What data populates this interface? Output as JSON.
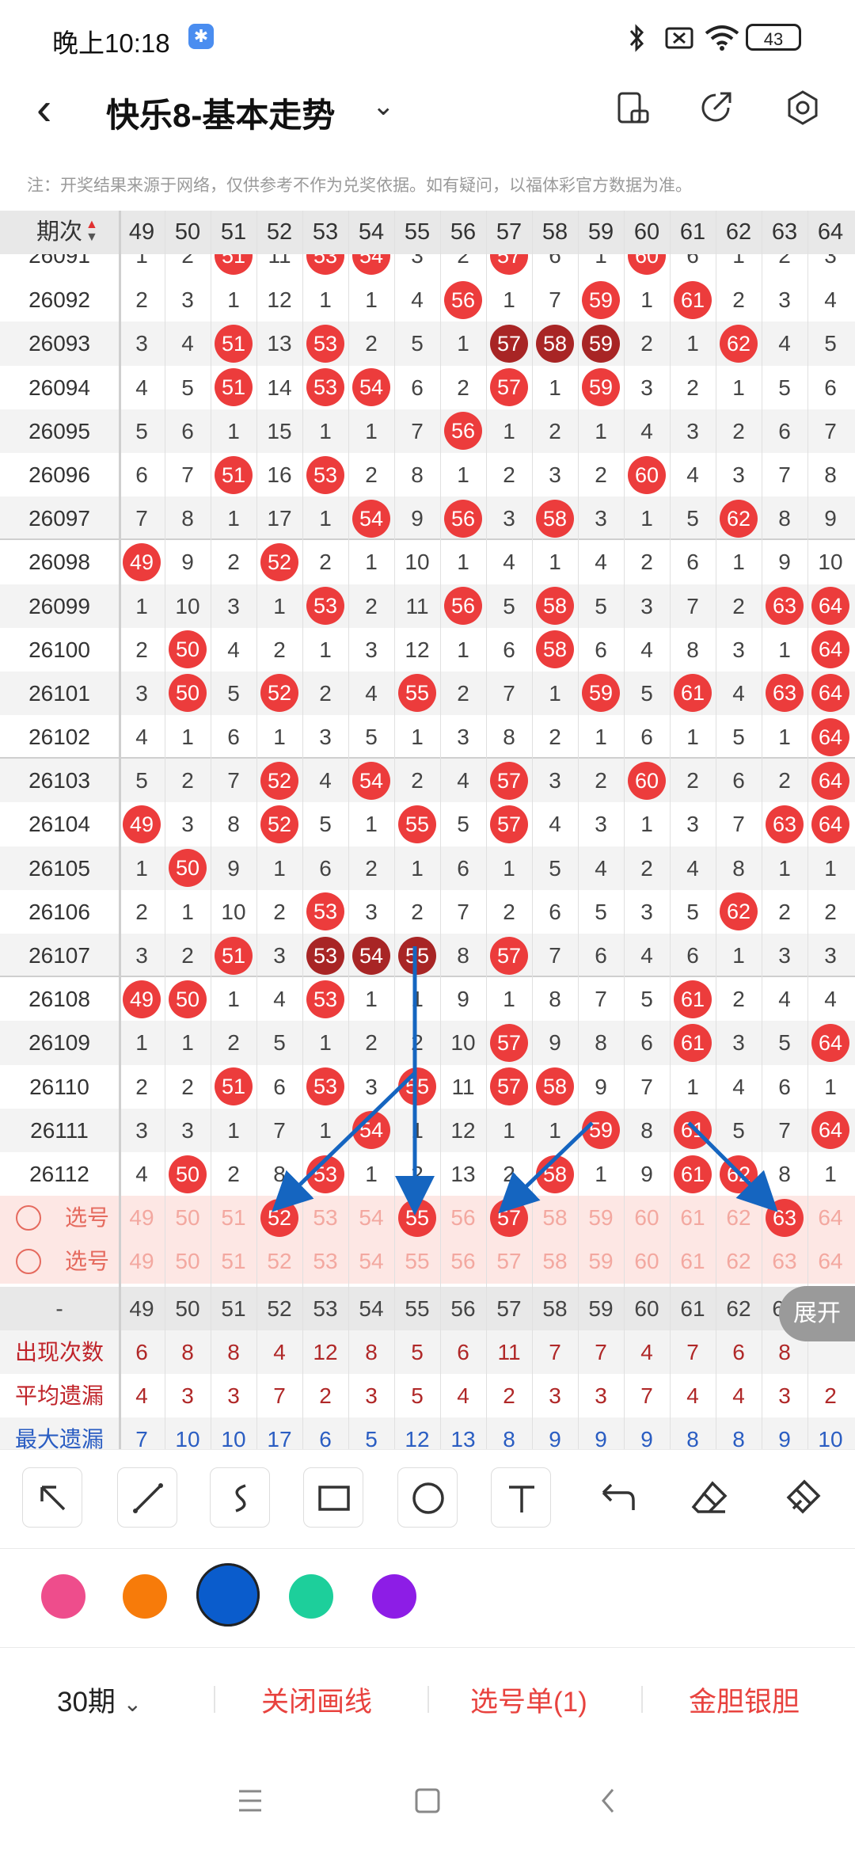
{
  "status_bar": {
    "time": "晚上10:18",
    "battery": "43"
  },
  "header": {
    "title": "快乐8-基本走势"
  },
  "notice": "注：开奖结果来源于网络，仅供参考不作为兑奖依据。如有疑问，以福体彩官方数据为准。",
  "table": {
    "period_header": "期次",
    "columns": [
      "49",
      "50",
      "51",
      "52",
      "53",
      "54",
      "55",
      "56",
      "57",
      "58",
      "59",
      "60",
      "61",
      "62",
      "63",
      "64"
    ],
    "partial_row": {
      "period": "26091",
      "cells": [
        "1",
        "2",
        "51",
        "11",
        "53",
        "54",
        "3",
        "2",
        "57",
        "6",
        "1",
        "60",
        "6",
        "1",
        "2",
        "3"
      ]
    },
    "rows": [
      {
        "period": "26092",
        "cells": [
          "2",
          "3",
          "1",
          "12",
          "1",
          "1",
          "4",
          "56",
          "1",
          "7",
          "59",
          "1",
          "61",
          "2",
          "3",
          "4"
        ]
      },
      {
        "period": "26093",
        "cells": [
          "3",
          "4",
          "51",
          "13",
          "53",
          "2",
          "5",
          "1",
          "57",
          "58",
          "59",
          "2",
          "1",
          "62",
          "4",
          "5"
        ]
      },
      {
        "period": "26094",
        "cells": [
          "4",
          "5",
          "51",
          "14",
          "53",
          "54",
          "6",
          "2",
          "57",
          "1",
          "59",
          "3",
          "2",
          "1",
          "5",
          "6"
        ]
      },
      {
        "period": "26095",
        "cells": [
          "5",
          "6",
          "1",
          "15",
          "1",
          "1",
          "7",
          "56",
          "1",
          "2",
          "1",
          "4",
          "3",
          "2",
          "6",
          "7"
        ]
      },
      {
        "period": "26096",
        "cells": [
          "6",
          "7",
          "51",
          "16",
          "53",
          "2",
          "8",
          "1",
          "2",
          "3",
          "2",
          "60",
          "4",
          "3",
          "7",
          "8"
        ]
      },
      {
        "period": "26097",
        "cells": [
          "7",
          "8",
          "1",
          "17",
          "1",
          "54",
          "9",
          "56",
          "3",
          "58",
          "3",
          "1",
          "5",
          "62",
          "8",
          "9"
        ]
      },
      {
        "period": "26098",
        "cells": [
          "49",
          "9",
          "2",
          "52",
          "2",
          "1",
          "10",
          "1",
          "4",
          "1",
          "4",
          "2",
          "6",
          "1",
          "9",
          "10"
        ]
      },
      {
        "period": "26099",
        "cells": [
          "1",
          "10",
          "3",
          "1",
          "53",
          "2",
          "11",
          "56",
          "5",
          "58",
          "5",
          "3",
          "7",
          "2",
          "63",
          "64"
        ]
      },
      {
        "period": "26100",
        "cells": [
          "2",
          "50",
          "4",
          "2",
          "1",
          "3",
          "12",
          "1",
          "6",
          "58",
          "6",
          "4",
          "8",
          "3",
          "1",
          "64"
        ]
      },
      {
        "period": "26101",
        "cells": [
          "3",
          "50",
          "5",
          "52",
          "2",
          "4",
          "55",
          "2",
          "7",
          "1",
          "59",
          "5",
          "61",
          "4",
          "63",
          "64"
        ]
      },
      {
        "period": "26102",
        "cells": [
          "4",
          "1",
          "6",
          "1",
          "3",
          "5",
          "1",
          "3",
          "8",
          "2",
          "1",
          "6",
          "1",
          "5",
          "1",
          "64"
        ]
      },
      {
        "period": "26103",
        "cells": [
          "5",
          "2",
          "7",
          "52",
          "4",
          "54",
          "2",
          "4",
          "57",
          "3",
          "2",
          "60",
          "2",
          "6",
          "2",
          "64"
        ]
      },
      {
        "period": "26104",
        "cells": [
          "49",
          "3",
          "8",
          "52",
          "5",
          "1",
          "55",
          "5",
          "57",
          "4",
          "3",
          "1",
          "3",
          "7",
          "63",
          "64"
        ]
      },
      {
        "period": "26105",
        "cells": [
          "1",
          "50",
          "9",
          "1",
          "6",
          "2",
          "1",
          "6",
          "1",
          "5",
          "4",
          "2",
          "4",
          "8",
          "1",
          "1"
        ]
      },
      {
        "period": "26106",
        "cells": [
          "2",
          "1",
          "10",
          "2",
          "53",
          "3",
          "2",
          "7",
          "2",
          "6",
          "5",
          "3",
          "5",
          "62",
          "2",
          "2"
        ]
      },
      {
        "period": "26107",
        "cells": [
          "3",
          "2",
          "51",
          "3",
          "53",
          "54",
          "55",
          "8",
          "57",
          "7",
          "6",
          "4",
          "6",
          "1",
          "3",
          "3"
        ]
      },
      {
        "period": "26108",
        "cells": [
          "49",
          "50",
          "1",
          "4",
          "53",
          "1",
          "1",
          "9",
          "1",
          "8",
          "7",
          "5",
          "61",
          "2",
          "4",
          "4"
        ]
      },
      {
        "period": "26109",
        "cells": [
          "1",
          "1",
          "2",
          "5",
          "1",
          "2",
          "2",
          "10",
          "57",
          "9",
          "8",
          "6",
          "61",
          "3",
          "5",
          "64"
        ]
      },
      {
        "period": "26110",
        "cells": [
          "2",
          "2",
          "51",
          "6",
          "53",
          "3",
          "55",
          "11",
          "57",
          "58",
          "9",
          "7",
          "1",
          "4",
          "6",
          "1"
        ]
      },
      {
        "period": "26111",
        "cells": [
          "3",
          "3",
          "1",
          "7",
          "1",
          "54",
          "1",
          "12",
          "1",
          "1",
          "59",
          "8",
          "61",
          "5",
          "7",
          "64"
        ]
      },
      {
        "period": "26112",
        "cells": [
          "4",
          "50",
          "2",
          "8",
          "53",
          "1",
          "2",
          "13",
          "2",
          "58",
          "1",
          "9",
          "61",
          "62",
          "8",
          "1"
        ]
      }
    ],
    "pick_rows": [
      {
        "label": "选号",
        "selected": [
          "52",
          "55",
          "57",
          "63"
        ]
      },
      {
        "label": "选号",
        "selected": []
      }
    ],
    "summary_header_label": "-",
    "stats": [
      {
        "label": "出现次数",
        "values": [
          "6",
          "8",
          "8",
          "4",
          "12",
          "8",
          "5",
          "6",
          "11",
          "7",
          "7",
          "4",
          "7",
          "6",
          "8",
          ""
        ]
      },
      {
        "label": "平均遗漏",
        "values": [
          "4",
          "3",
          "3",
          "7",
          "2",
          "3",
          "5",
          "4",
          "2",
          "3",
          "3",
          "7",
          "4",
          "4",
          "3",
          "2"
        ]
      },
      {
        "label": "最大遗漏",
        "values": [
          "7",
          "10",
          "10",
          "17",
          "6",
          "5",
          "12",
          "13",
          "8",
          "9",
          "9",
          "9",
          "8",
          "8",
          "9",
          "10"
        ]
      }
    ],
    "expand_label": "展开"
  },
  "draw_tools": [
    "arrow-tool-icon",
    "line-tool-icon",
    "curve-tool-icon",
    "rectangle-tool-icon",
    "circle-tool-icon",
    "text-tool-icon",
    "undo-icon",
    "eraser-icon",
    "clear-icon"
  ],
  "palette": [
    "#ee4d8c",
    "#f77b0a",
    "#0a5ccc",
    "#1dcf9b",
    "#8d1de6"
  ],
  "bottom_bar": {
    "period_select": "30期",
    "close_lines": "关闭画线",
    "pick_list": "选号单(1)",
    "golden": "金胆银胆"
  },
  "colors": {
    "ball_red": "#ec3c3c",
    "ball_dark": "#a82525",
    "arrow": "#1565c0",
    "accent_red": "#e8423e"
  }
}
